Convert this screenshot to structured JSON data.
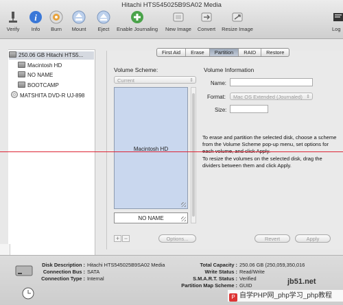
{
  "window": {
    "title": "Hitachi HTS545025B9SA02 Media"
  },
  "toolbar": {
    "verify": "Verify",
    "info": "Info",
    "burn": "Burn",
    "mount": "Mount",
    "eject": "Eject",
    "enable_journaling": "Enable Journaling",
    "new_image": "New Image",
    "convert": "Convert",
    "resize_image": "Resize Image",
    "log": "Log"
  },
  "sidebar": {
    "items": [
      {
        "label": "250.06 GB Hitachi HTS5...",
        "type": "disk",
        "selected": true
      },
      {
        "label": "Macintosh HD",
        "type": "volume"
      },
      {
        "label": "NO NAME",
        "type": "volume"
      },
      {
        "label": "BOOTCAMP",
        "type": "volume"
      },
      {
        "label": "MATSHITA DVD-R UJ-898",
        "type": "optical"
      }
    ]
  },
  "tabs": [
    "First Aid",
    "Erase",
    "Partition",
    "RAID",
    "Restore"
  ],
  "active_tab": "Partition",
  "partition": {
    "scheme_label": "Volume Scheme:",
    "scheme_value": "Current",
    "info_label": "Volume Information",
    "name_label": "Name:",
    "name_value": "",
    "format_label": "Format:",
    "format_value": "Mac OS Extended (Journaled)",
    "size_label": "Size:",
    "size_value": "",
    "volumes": [
      "Macintosh HD",
      "NO NAME"
    ],
    "options_button": "Options...",
    "add_button": "+",
    "remove_button": "−",
    "revert_button": "Revert",
    "apply_button": "Apply",
    "info_line1": "To erase and partition the selected disk, choose a scheme from the Volume Scheme pop-up menu, set options for each volume, and click Apply.",
    "info_line2": "To resize the volumes on the selected disk, drag the dividers between them and click Apply."
  },
  "details": {
    "disk_description_label": "Disk Description :",
    "disk_description": "Hitachi HTS545025B9SA02 Media",
    "connection_bus_label": "Connection Bus :",
    "connection_bus": "SATA",
    "connection_type_label": "Connection Type :",
    "connection_type": "Internal",
    "total_capacity_label": "Total Capacity :",
    "total_capacity": "250.06 GB (250,059,350,016",
    "write_status_label": "Write Status :",
    "write_status": "Read/Write",
    "smart_status_label": "S.M.A.R.T. Status :",
    "smart_status": "Verified",
    "partition_map_label": "Partition Map Scheme :",
    "partition_map": "GUID"
  },
  "watermark": {
    "site": "jb51.net",
    "text": "自学PHP网_php学习_php教程"
  },
  "colors": {
    "accent": "#c9d7ee",
    "selection": "#d5d9e0",
    "guide_line": "#dd2233"
  }
}
